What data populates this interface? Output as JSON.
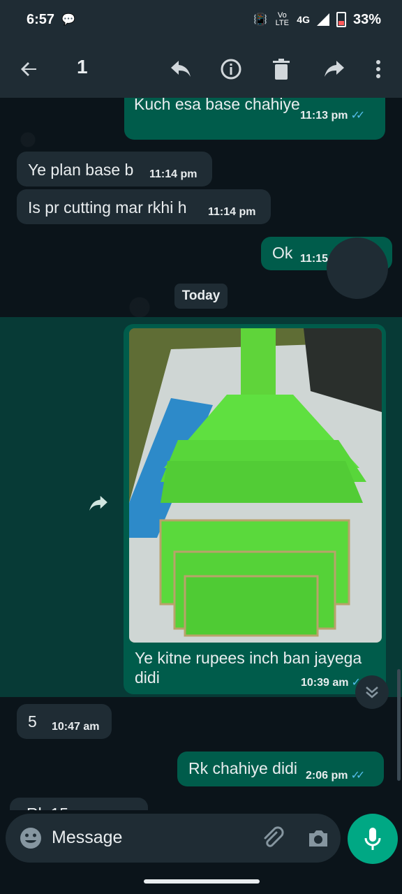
{
  "status_bar": {
    "time": "6:57",
    "network": "4G",
    "volte": "Vo LTE",
    "battery": "33%"
  },
  "action_bar": {
    "selected_count": "1"
  },
  "messages": [
    {
      "type": "out",
      "text": "Kuch esa base chahiye",
      "time": "11:13 pm"
    },
    {
      "type": "in",
      "text": "Ye plan base b",
      "time": "11:14 pm"
    },
    {
      "type": "in",
      "text": "Is pr cutting mar rkhi h",
      "time": "11:14 pm"
    },
    {
      "type": "out",
      "text": "Ok",
      "time": "11:15"
    },
    {
      "type": "out_image",
      "caption_line1": "Ye kitne rupees inch ban jayega",
      "caption_line2": "didi",
      "time": "10:39 am"
    },
    {
      "type": "in",
      "text": "5",
      "time": "10:47 am"
    },
    {
      "type": "out",
      "text": "Rk chahiye didi",
      "time": "2:06 pm"
    },
    {
      "type": "in",
      "text": "Rk 15",
      "time": ""
    }
  ],
  "day_divider": "Today",
  "compose": {
    "placeholder": "Message"
  },
  "colors": {
    "outgoing_bubble": "#005c4b",
    "incoming_bubble": "#1f2c34",
    "accent": "#00a884",
    "read_ticks": "#53bdeb"
  }
}
